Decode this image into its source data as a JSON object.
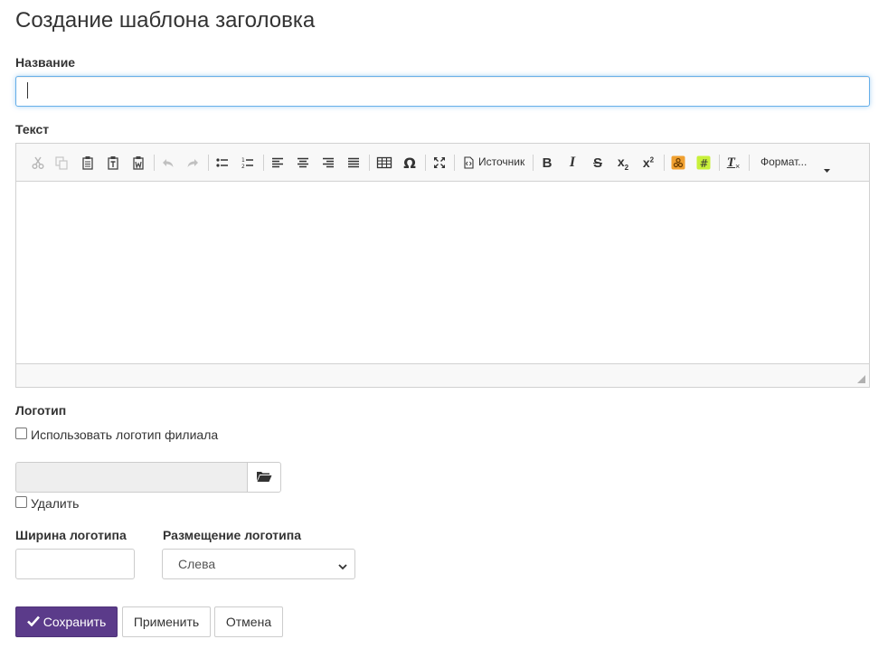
{
  "page": {
    "title": "Создание шаблона заголовка"
  },
  "name_field": {
    "label": "Название",
    "value": ""
  },
  "text_field": {
    "label": "Текст",
    "toolbar": {
      "source_label": "Источник",
      "format_label": "Формат..."
    }
  },
  "logo": {
    "section_label": "Логотип",
    "use_branch_logo_label": "Использовать логотип филиала",
    "use_branch_logo_checked": false,
    "file_value": "",
    "delete_label": "Удалить",
    "delete_checked": false
  },
  "logo_width": {
    "label": "Ширина логотипа",
    "value": ""
  },
  "logo_position": {
    "label": "Размещение логотипа",
    "selected": "Слева"
  },
  "actions": {
    "save_label": "Сохранить",
    "apply_label": "Применить",
    "cancel_label": "Отмена"
  },
  "colors": {
    "primary": "#5b3b8a",
    "focus": "#66afe9",
    "toolbar_bg": "#f8f8f8"
  }
}
